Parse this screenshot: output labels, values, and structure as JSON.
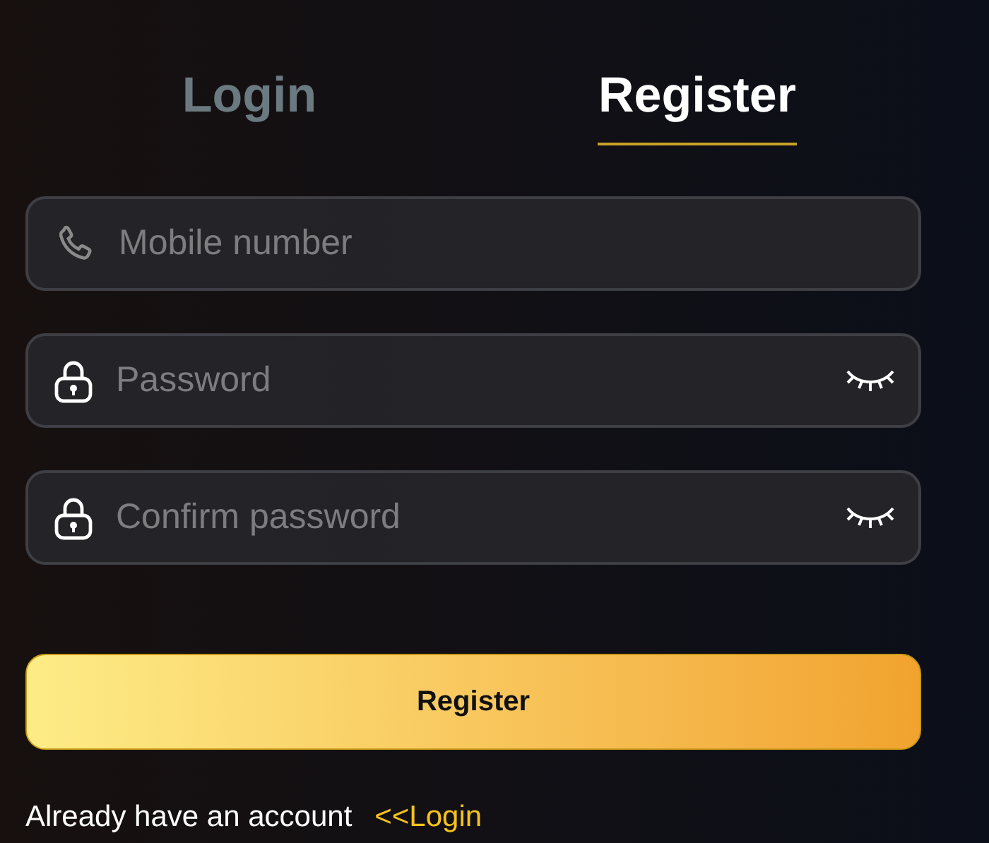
{
  "tabs": [
    {
      "label": "Login",
      "selected": false
    },
    {
      "label": "Register",
      "selected": true
    }
  ],
  "fields": [
    {
      "kind": "phone",
      "placeholder": "Mobile number"
    },
    {
      "kind": "password",
      "placeholder": "Password",
      "visible": false
    },
    {
      "kind": "password",
      "placeholder": "Confirm password",
      "visible": false
    }
  ],
  "submit_button": "Register",
  "footer": {
    "text": "Already have an account",
    "link": "<<Login"
  }
}
